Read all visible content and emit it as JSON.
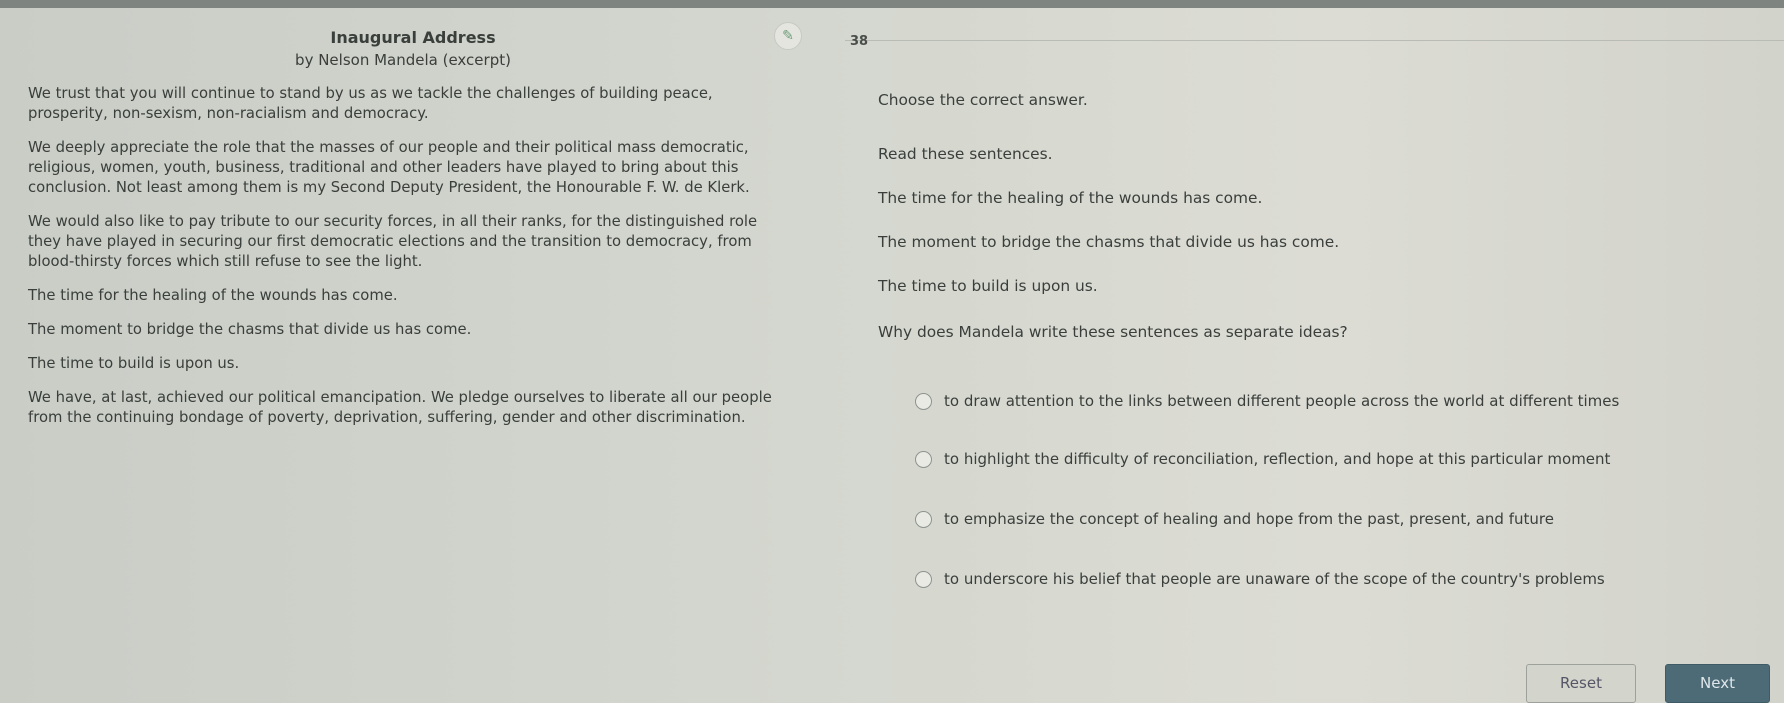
{
  "passage": {
    "title": "Inaugural Address",
    "byline": "by Nelson Mandela (excerpt)",
    "paragraphs": [
      "We trust that you will continue to stand by us as we tackle the challenges of building peace, prosperity, non-sexism, non-racialism and democracy.",
      "We deeply appreciate the role that the masses of our people and their political mass democratic, religious, women, youth, business, traditional and other leaders have played to bring about this conclusion. Not least among them is my Second Deputy President, the Honourable F. W. de Klerk.",
      "We would also like to pay tribute to our security forces, in all their ranks, for the distinguished role they have played in securing our first democratic elections and the transition to democracy, from blood-thirsty forces which still refuse to see the light.",
      "The time for the healing of the wounds has come.",
      "The moment to bridge the chasms that divide us has come.",
      "The time to build is upon us.",
      "We have, at last, achieved our political emancipation. We pledge ourselves to liberate all our people from the continuing bondage of poverty, deprivation, suffering, gender and other discrimination."
    ]
  },
  "toolbar": {
    "tool_icon": "pencil-icon",
    "question_number": "38"
  },
  "question": {
    "instruction": "Choose the correct answer.",
    "prompt": "Read these sentences.",
    "quotes": [
      "The time for the healing of the wounds has come.",
      "The moment to bridge the chasms that divide us has come.",
      "The time to build is upon us."
    ],
    "ask": "Why does Mandela write these sentences as separate ideas?",
    "options": [
      "to draw attention to the links between different people across the world at different times",
      "to highlight the difficulty of reconciliation, reflection, and hope at this particular moment",
      "to emphasize the concept of healing and hope from the past, present, and future",
      "to underscore his belief that people are unaware of the scope of the country's problems"
    ]
  },
  "buttons": {
    "reset": "Reset",
    "next": "Next"
  }
}
